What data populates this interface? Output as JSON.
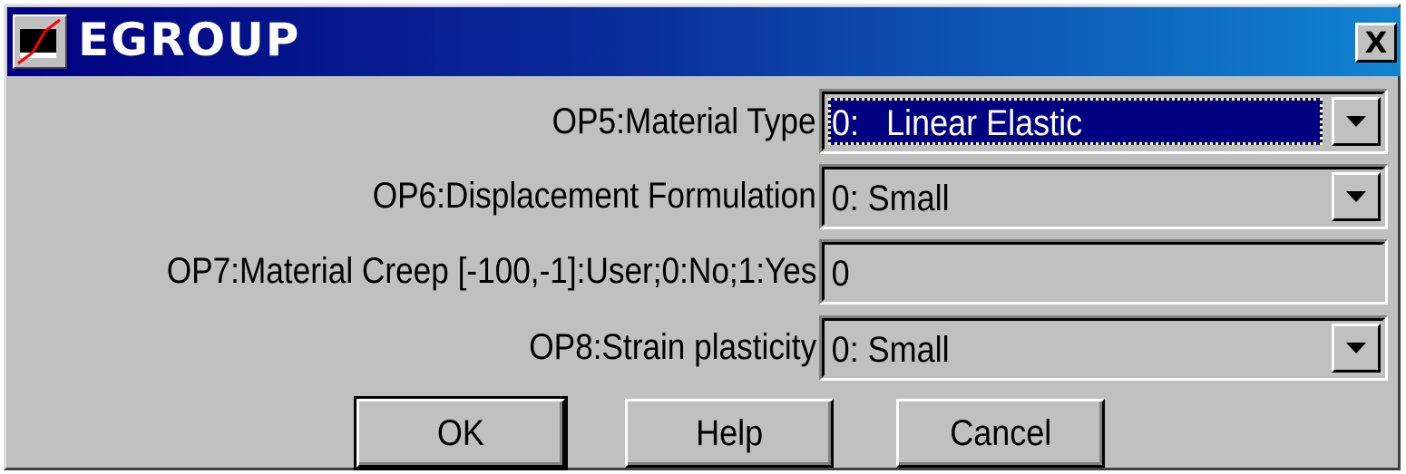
{
  "window": {
    "title": "EGROUP",
    "close_label": "X"
  },
  "rows": [
    {
      "label": "OP5:Material Type",
      "value": "0:   Linear Elastic",
      "type": "select"
    },
    {
      "label": "OP6:Displacement Formulation",
      "value": "0: Small",
      "type": "select"
    },
    {
      "label": "OP7:Material Creep [-100,-1]:User;0:No;1:Yes",
      "value": "0",
      "type": "text"
    },
    {
      "label": "OP8:Strain plasticity",
      "value": "0: Small",
      "type": "select"
    }
  ],
  "buttons": {
    "ok": "OK",
    "help": "Help",
    "cancel": "Cancel"
  },
  "icons": {
    "app": "app-icon",
    "close": "close-icon",
    "dropdown": "chevron-down-icon"
  },
  "colors": {
    "titlebar_start": "#000080",
    "titlebar_end": "#1084d0",
    "selection": "#000080",
    "face": "#c0c0c0"
  }
}
